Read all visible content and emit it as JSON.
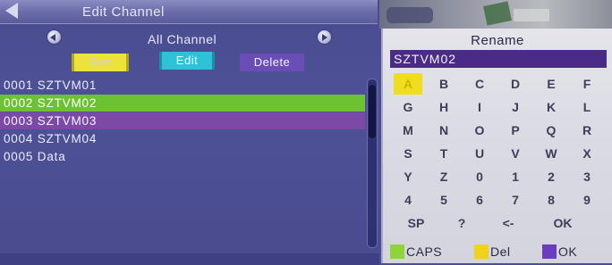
{
  "window": {
    "title": "Edit Channel"
  },
  "group_selector": {
    "label": "All Channel"
  },
  "actions": {
    "sort_label": "Sort",
    "edit_label": "Edit",
    "delete_label": "Delete"
  },
  "channels": [
    {
      "number": "0001",
      "name": "SZTVM01",
      "state": "normal"
    },
    {
      "number": "0002",
      "name": "SZTVM02",
      "state": "focused"
    },
    {
      "number": "0003",
      "name": "SZTVM03",
      "state": "marked"
    },
    {
      "number": "0004",
      "name": "SZTVM04",
      "state": "normal"
    },
    {
      "number": "0005",
      "name": "Data",
      "state": "normal"
    }
  ],
  "rename": {
    "title": "Rename",
    "current_value": "SZTVM02"
  },
  "keyboard": {
    "focused_key": "A",
    "rows": [
      [
        "A",
        "B",
        "C",
        "D",
        "E",
        "F"
      ],
      [
        "G",
        "H",
        "I",
        "J",
        "K",
        "L"
      ],
      [
        "M",
        "N",
        "O",
        "P",
        "Q",
        "R"
      ],
      [
        "S",
        "T",
        "U",
        "V",
        "W",
        "X"
      ],
      [
        "Y",
        "Z",
        "0",
        "1",
        "2",
        "3"
      ],
      [
        "4",
        "5",
        "6",
        "7",
        "8",
        "9"
      ]
    ],
    "bottom_row": [
      "SP",
      "?",
      "<-",
      "OK"
    ]
  },
  "legend": [
    {
      "color": "#8fd43a",
      "label": "CAPS"
    },
    {
      "color": "#f0d21c",
      "label": "Del"
    },
    {
      "color": "#6a3cc0",
      "label": "OK"
    }
  ],
  "colors": {
    "focus_row": "#6cc232",
    "marked_row": "#7c4aa6",
    "sort_button": "#ece23a",
    "edit_button": "#2ec2d8",
    "delete_button": "#6a4db6"
  },
  "icons": {
    "back": "back-arrow-icon",
    "prev_group": "left-round-arrow-icon",
    "next_group": "right-round-arrow-icon"
  }
}
